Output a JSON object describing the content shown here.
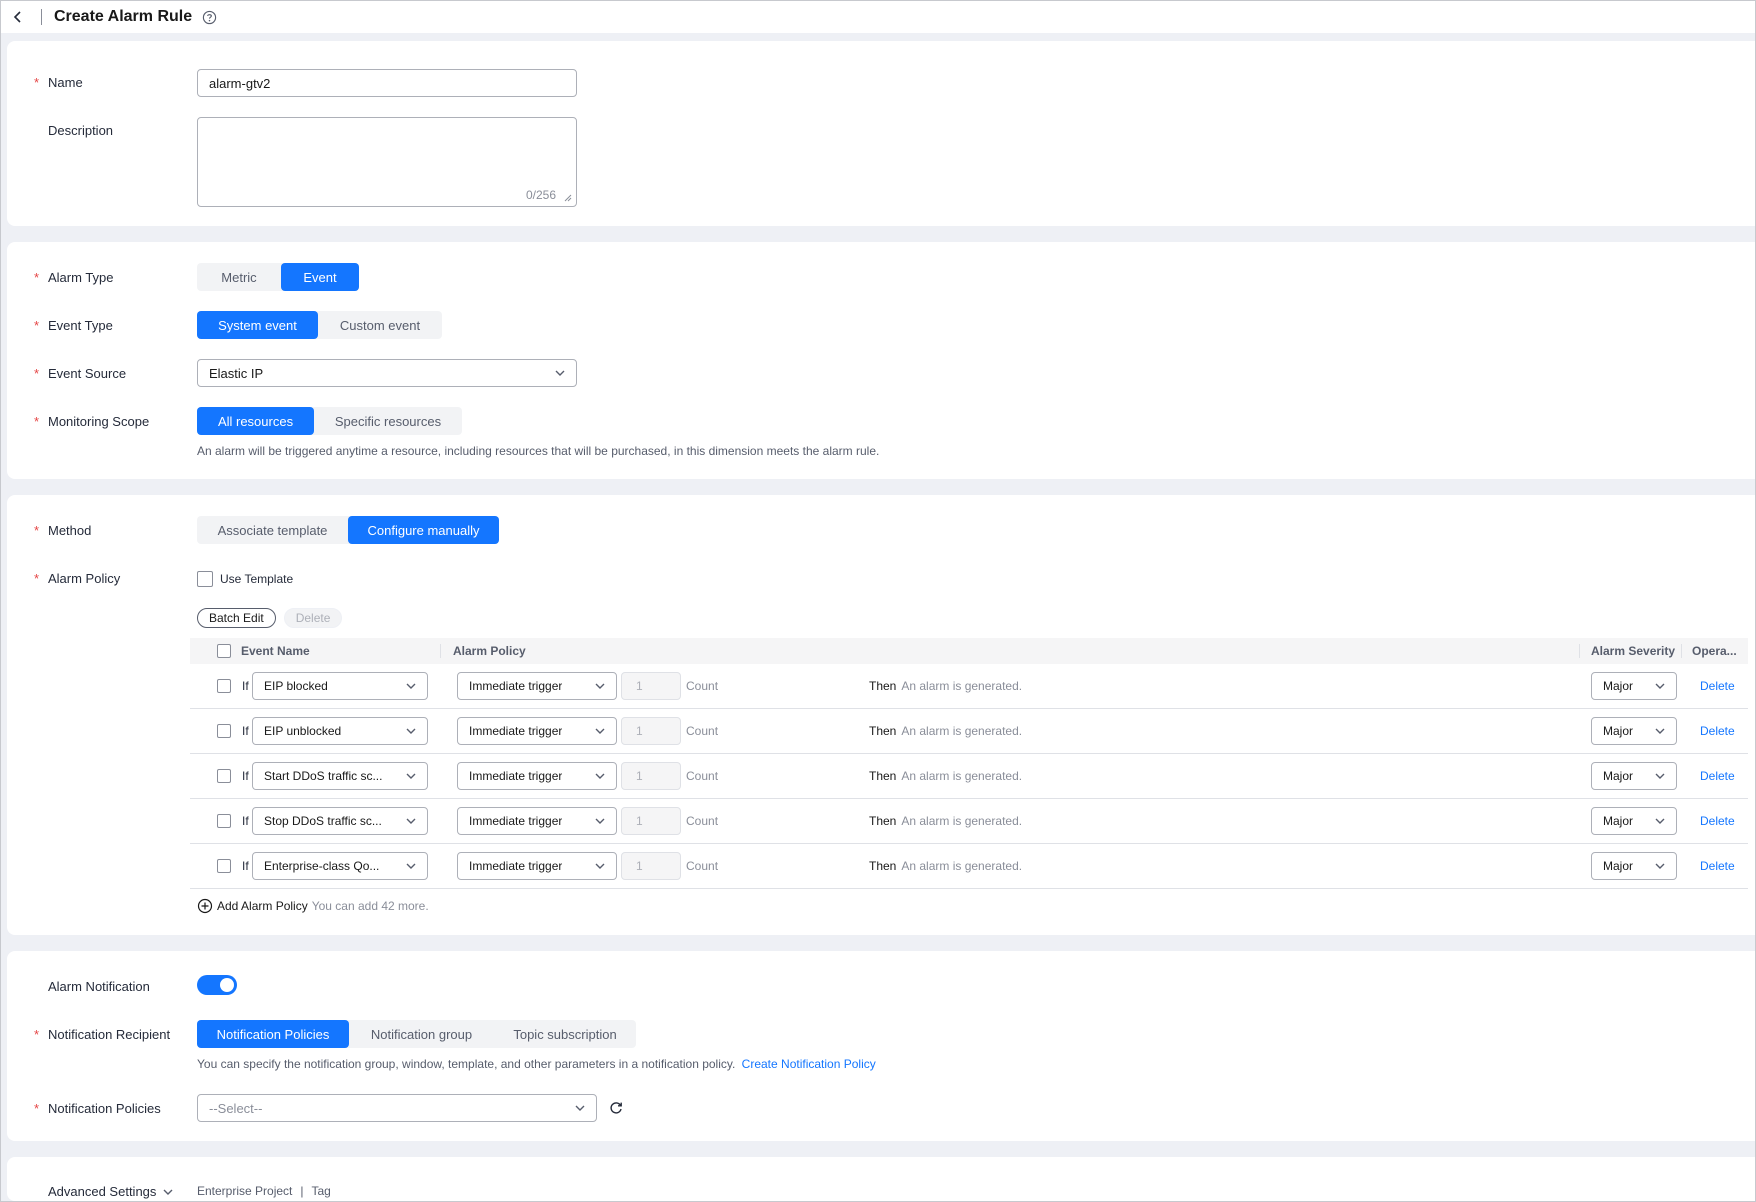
{
  "header": {
    "title": "Create Alarm Rule"
  },
  "basic": {
    "name_label": "Name",
    "name_value": "alarm-gtv2",
    "description_label": "Description",
    "description_counter": "0/256"
  },
  "alarm_type": {
    "label": "Alarm Type",
    "options": [
      "Metric",
      "Event"
    ],
    "selected": "Event"
  },
  "event_type": {
    "label": "Event Type",
    "options": [
      "System event",
      "Custom event"
    ],
    "selected": "System event"
  },
  "event_source": {
    "label": "Event Source",
    "value": "Elastic IP"
  },
  "monitoring_scope": {
    "label": "Monitoring Scope",
    "options": [
      "All resources",
      "Specific resources"
    ],
    "selected": "All resources",
    "hint": "An alarm will be triggered anytime a resource, including resources that will be purchased, in this dimension meets the alarm rule."
  },
  "method": {
    "label": "Method",
    "options": [
      "Associate template",
      "Configure manually"
    ],
    "selected": "Configure manually"
  },
  "alarm_policy": {
    "label": "Alarm Policy",
    "use_template_label": "Use Template",
    "batch_edit_label": "Batch Edit",
    "delete_label": "Delete",
    "columns": {
      "event_name": "Event Name",
      "alarm_policy": "Alarm Policy",
      "alarm_severity": "Alarm Severity",
      "operation": "Opera..."
    },
    "if_label": "If",
    "count_label": "Count",
    "then_label": "Then",
    "generated_label": "An alarm is generated.",
    "rows": [
      {
        "event": "EIP blocked",
        "trigger": "Immediate trigger",
        "count": "1",
        "severity": "Major",
        "op": "Delete"
      },
      {
        "event": "EIP unblocked",
        "trigger": "Immediate trigger",
        "count": "1",
        "severity": "Major",
        "op": "Delete"
      },
      {
        "event": "Start DDoS traffic sc...",
        "trigger": "Immediate trigger",
        "count": "1",
        "severity": "Major",
        "op": "Delete"
      },
      {
        "event": "Stop DDoS traffic sc...",
        "trigger": "Immediate trigger",
        "count": "1",
        "severity": "Major",
        "op": "Delete"
      },
      {
        "event": "Enterprise-class Qo...",
        "trigger": "Immediate trigger",
        "count": "1",
        "severity": "Major",
        "op": "Delete"
      }
    ],
    "add_label": "Add Alarm Policy",
    "add_hint": "You can add 42 more."
  },
  "notification": {
    "toggle_label": "Alarm Notification",
    "enabled": true,
    "recipient_label": "Notification Recipient",
    "recipient_options": [
      "Notification Policies",
      "Notification group",
      "Topic subscription"
    ],
    "recipient_selected": "Notification Policies",
    "recipient_hint": "You can specify the notification group, window, template, and other parameters in a notification policy.",
    "create_policy_link": "Create Notification Policy",
    "policies_label": "Notification Policies",
    "policies_placeholder": "--Select--"
  },
  "advanced": {
    "label": "Advanced Settings",
    "items": [
      "Enterprise Project",
      "Tag"
    ],
    "separator": "|"
  },
  "colors": {
    "primary": "#1476ff",
    "required": "#e54545",
    "background": "#eef0f5"
  }
}
